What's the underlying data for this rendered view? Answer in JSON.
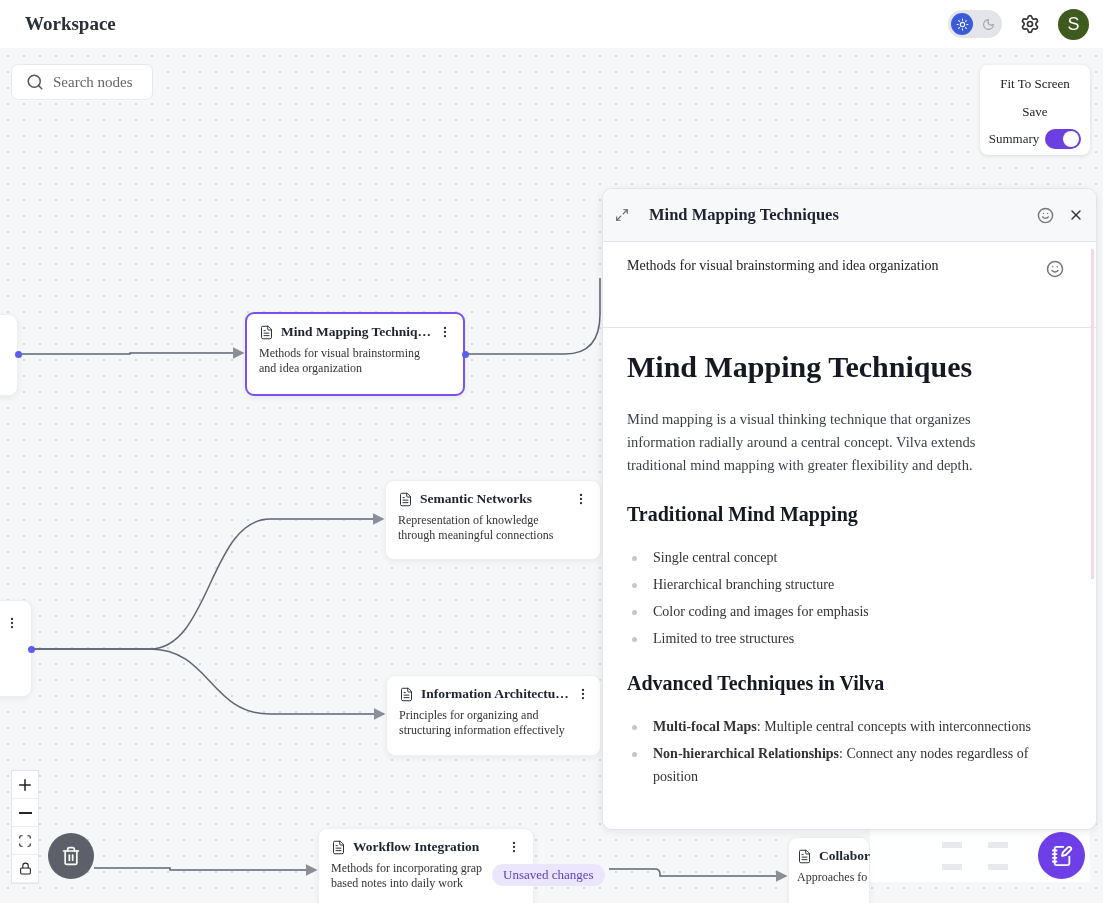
{
  "header": {
    "title": "Workspace",
    "theme_options": [
      {
        "kind": "light",
        "selected": true
      },
      {
        "kind": "dark",
        "selected": false
      }
    ],
    "avatar": "S"
  },
  "search": {
    "placeholder": "Search nodes"
  },
  "controls": {
    "buttons": [
      "Fit To Screen",
      "Save"
    ],
    "summary": {
      "label": "Summary",
      "on": true
    }
  },
  "nodes": [
    {
      "kind": "stub",
      "menu": false,
      "selected": false
    },
    {
      "kind": "card",
      "title": "Mind Mapping Techniq…",
      "description": "Methods for visual brainstorming\nand idea organization",
      "selected": true
    },
    {
      "kind": "card",
      "title": "Semantic Networks",
      "description": "Representation of knowledge\nthrough meaningful connections",
      "selected": false
    },
    {
      "kind": "stub",
      "menu": true,
      "selected": false
    },
    {
      "kind": "card",
      "title": "Information Architectu…",
      "description": "Principles for organizing and\nstructuring information effectively",
      "selected": false
    },
    {
      "kind": "card",
      "title": "Workflow Integration",
      "description": "Methods for incorporating grap\nbased notes into daily work",
      "selected": false
    },
    {
      "kind": "card",
      "title": "Collabor",
      "description": "Approaches fo",
      "selected": false
    }
  ],
  "status_badge": "Unsaved changes",
  "panel": {
    "title": "Mind Mapping Techniques",
    "description": "Methods for visual brainstorming and idea organization",
    "content": [
      {
        "kind": "h1",
        "text": "Mind Mapping Techniques"
      },
      {
        "kind": "p",
        "text": "Mind mapping is a visual thinking technique that organizes information radially around a central concept. Vilva extends traditional mind mapping with greater flexibility and depth."
      },
      {
        "kind": "h2",
        "text": "Traditional Mind Mapping"
      },
      {
        "kind": "ul",
        "items": [
          "Single central concept",
          "Hierarchical branching structure",
          "Color coding and images for emphasis",
          "Limited to tree structures"
        ]
      },
      {
        "kind": "h2",
        "text": "Advanced Techniques in Vilva"
      },
      {
        "kind": "ul",
        "items": [
          "**Multi-focal Maps**: Multiple central concepts with interconnections",
          "**Non-hierarchical Relationships**: Connect any nodes regardless of position"
        ]
      }
    ]
  }
}
